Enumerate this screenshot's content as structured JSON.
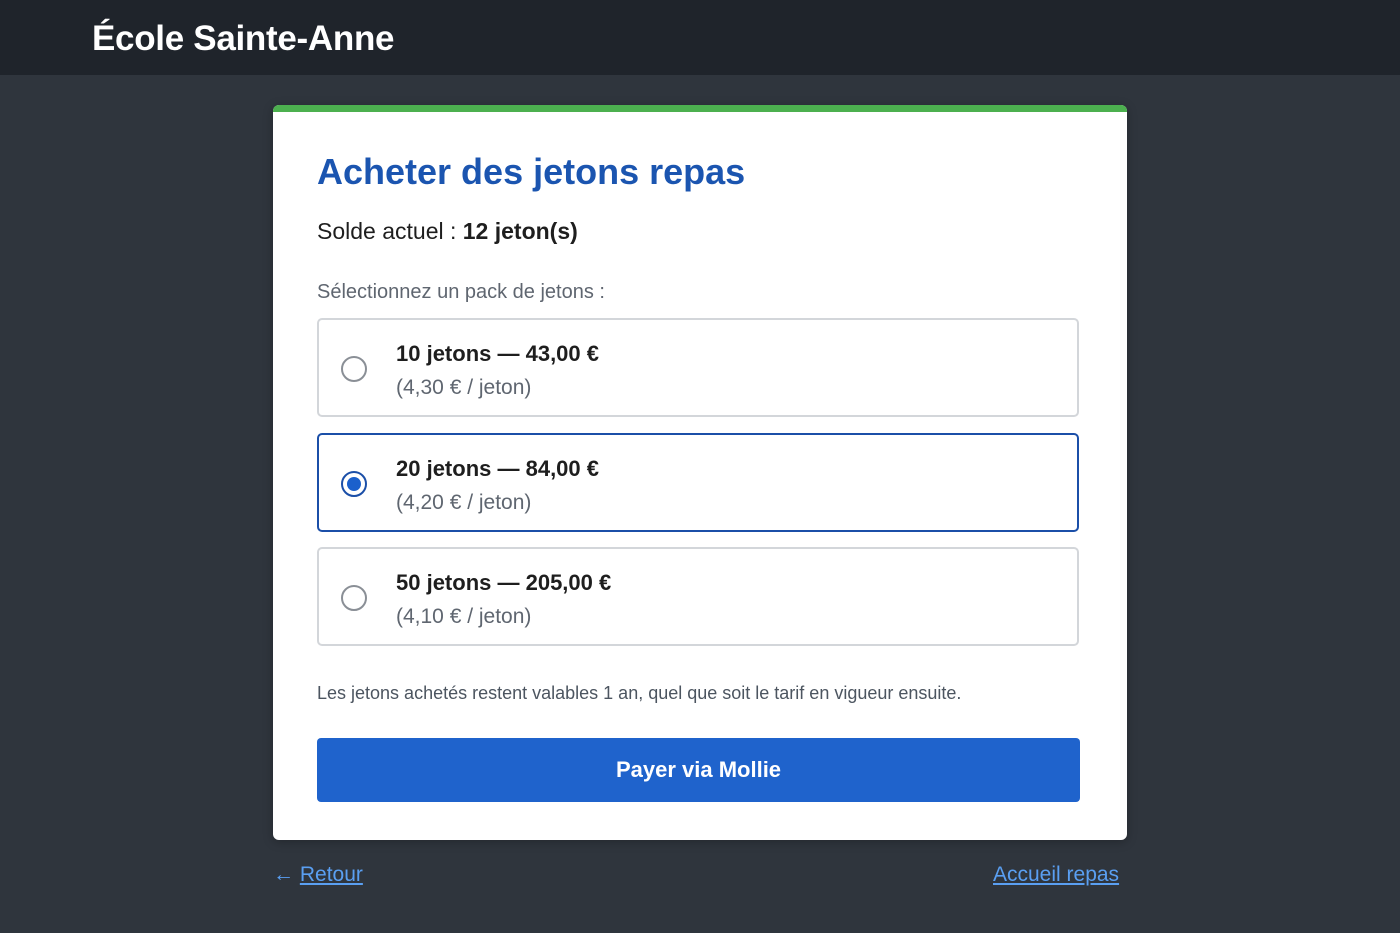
{
  "header": {
    "brand": "École Sainte-Anne"
  },
  "card": {
    "title": "Acheter des jetons repas",
    "balance_label": "Solde actuel : ",
    "balance_value": "12 jeton(s)",
    "select_label": "Sélectionnez un pack de jetons :",
    "options": [
      {
        "title": "10 jetons — 43,00 €",
        "unit_price": "(4,30 € / jeton)",
        "selected": false
      },
      {
        "title": "20 jetons — 84,00 €",
        "unit_price": "(4,20 € / jeton)",
        "selected": true
      },
      {
        "title": "50 jetons — 205,00 €",
        "unit_price": "(4,10 € / jeton)",
        "selected": false
      }
    ],
    "note": "Les jetons achetés restent valables 1 an, quel que soit le tarif en vigueur ensuite.",
    "pay_button": "Payer via Mollie"
  },
  "footer": {
    "back_arrow": "←",
    "back_label": "Retour",
    "home_label": "Accueil repas"
  },
  "colors": {
    "accent_green": "#4cb04f",
    "primary_blue": "#1f63cc",
    "title_blue": "#1b55b0",
    "link_blue": "#5a9ff2",
    "background": "#2f353d",
    "topbar": "#1f242b"
  }
}
